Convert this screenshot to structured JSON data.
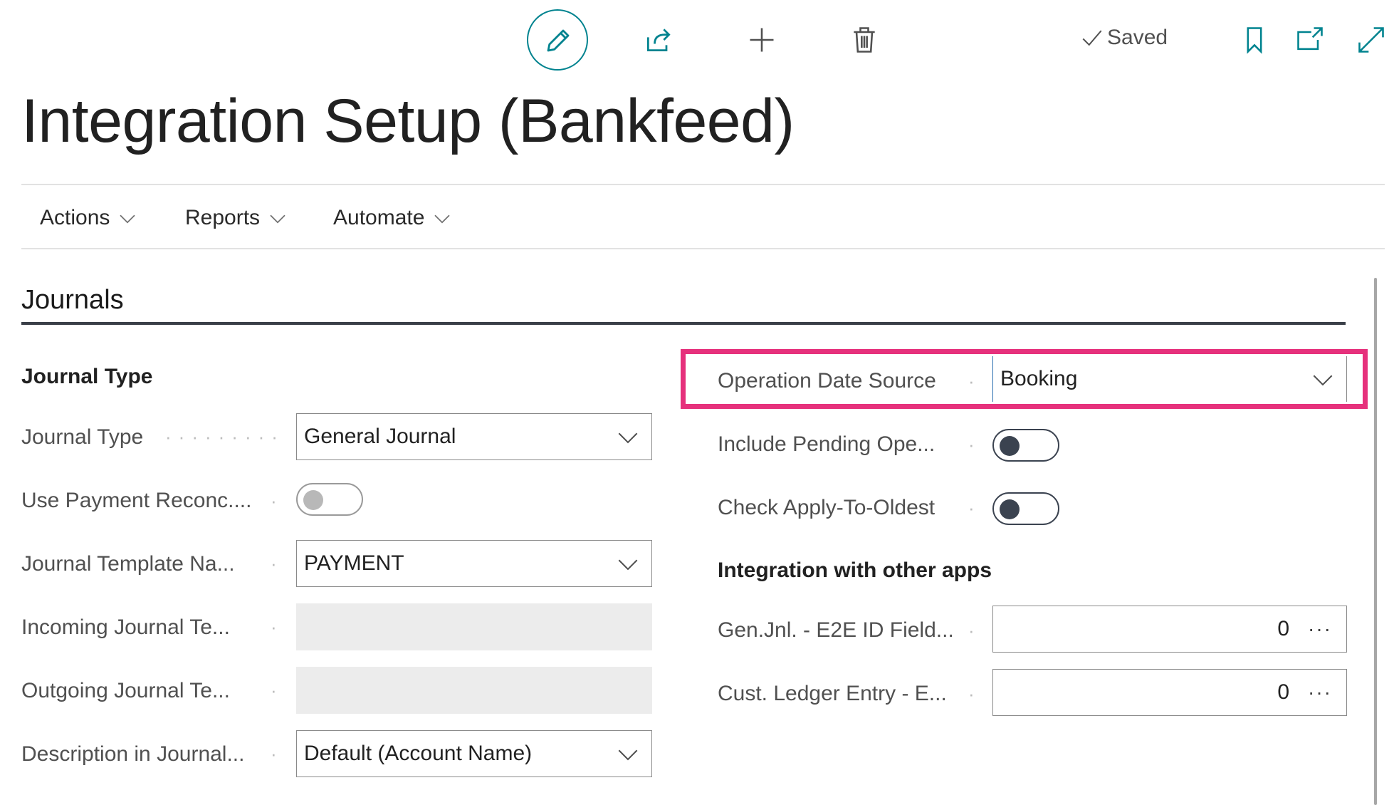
{
  "header": {
    "title": "Integration Setup (Bankfeed)",
    "status": "Saved"
  },
  "menu": [
    {
      "label": "Actions"
    },
    {
      "label": "Reports"
    },
    {
      "label": "Automate"
    }
  ],
  "section": {
    "title": "Journals"
  },
  "left": {
    "group_title": "Journal Type",
    "fields": [
      {
        "label": "Journal Type",
        "value": "General Journal",
        "type": "select"
      },
      {
        "label": "Use Payment Reconc....",
        "value": "off",
        "type": "toggle"
      },
      {
        "label": "Journal Template Na...",
        "value": "PAYMENT",
        "type": "select"
      },
      {
        "label": "Incoming Journal Te...",
        "value": "",
        "type": "readonly"
      },
      {
        "label": "Outgoing Journal Te...",
        "value": "",
        "type": "readonly"
      },
      {
        "label": "Description in Journal...",
        "value": "Default (Account Name)",
        "type": "select"
      }
    ]
  },
  "right": {
    "fields": [
      {
        "label": "Operation Date Source",
        "value": "Booking",
        "type": "select"
      },
      {
        "label": "Include Pending Ope...",
        "value": "off",
        "type": "toggle"
      },
      {
        "label": "Check Apply-To-Oldest",
        "value": "off",
        "type": "toggle"
      }
    ],
    "group_title": "Integration with other apps",
    "lookup_fields": [
      {
        "label": "Gen.Jnl. - E2E ID Field...",
        "value": "0"
      },
      {
        "label": "Cust. Ledger Entry - E...",
        "value": "0"
      }
    ]
  },
  "colors": {
    "accent": "#00838f",
    "highlight": "#e6317c",
    "toggle_on": "#3b4350"
  }
}
